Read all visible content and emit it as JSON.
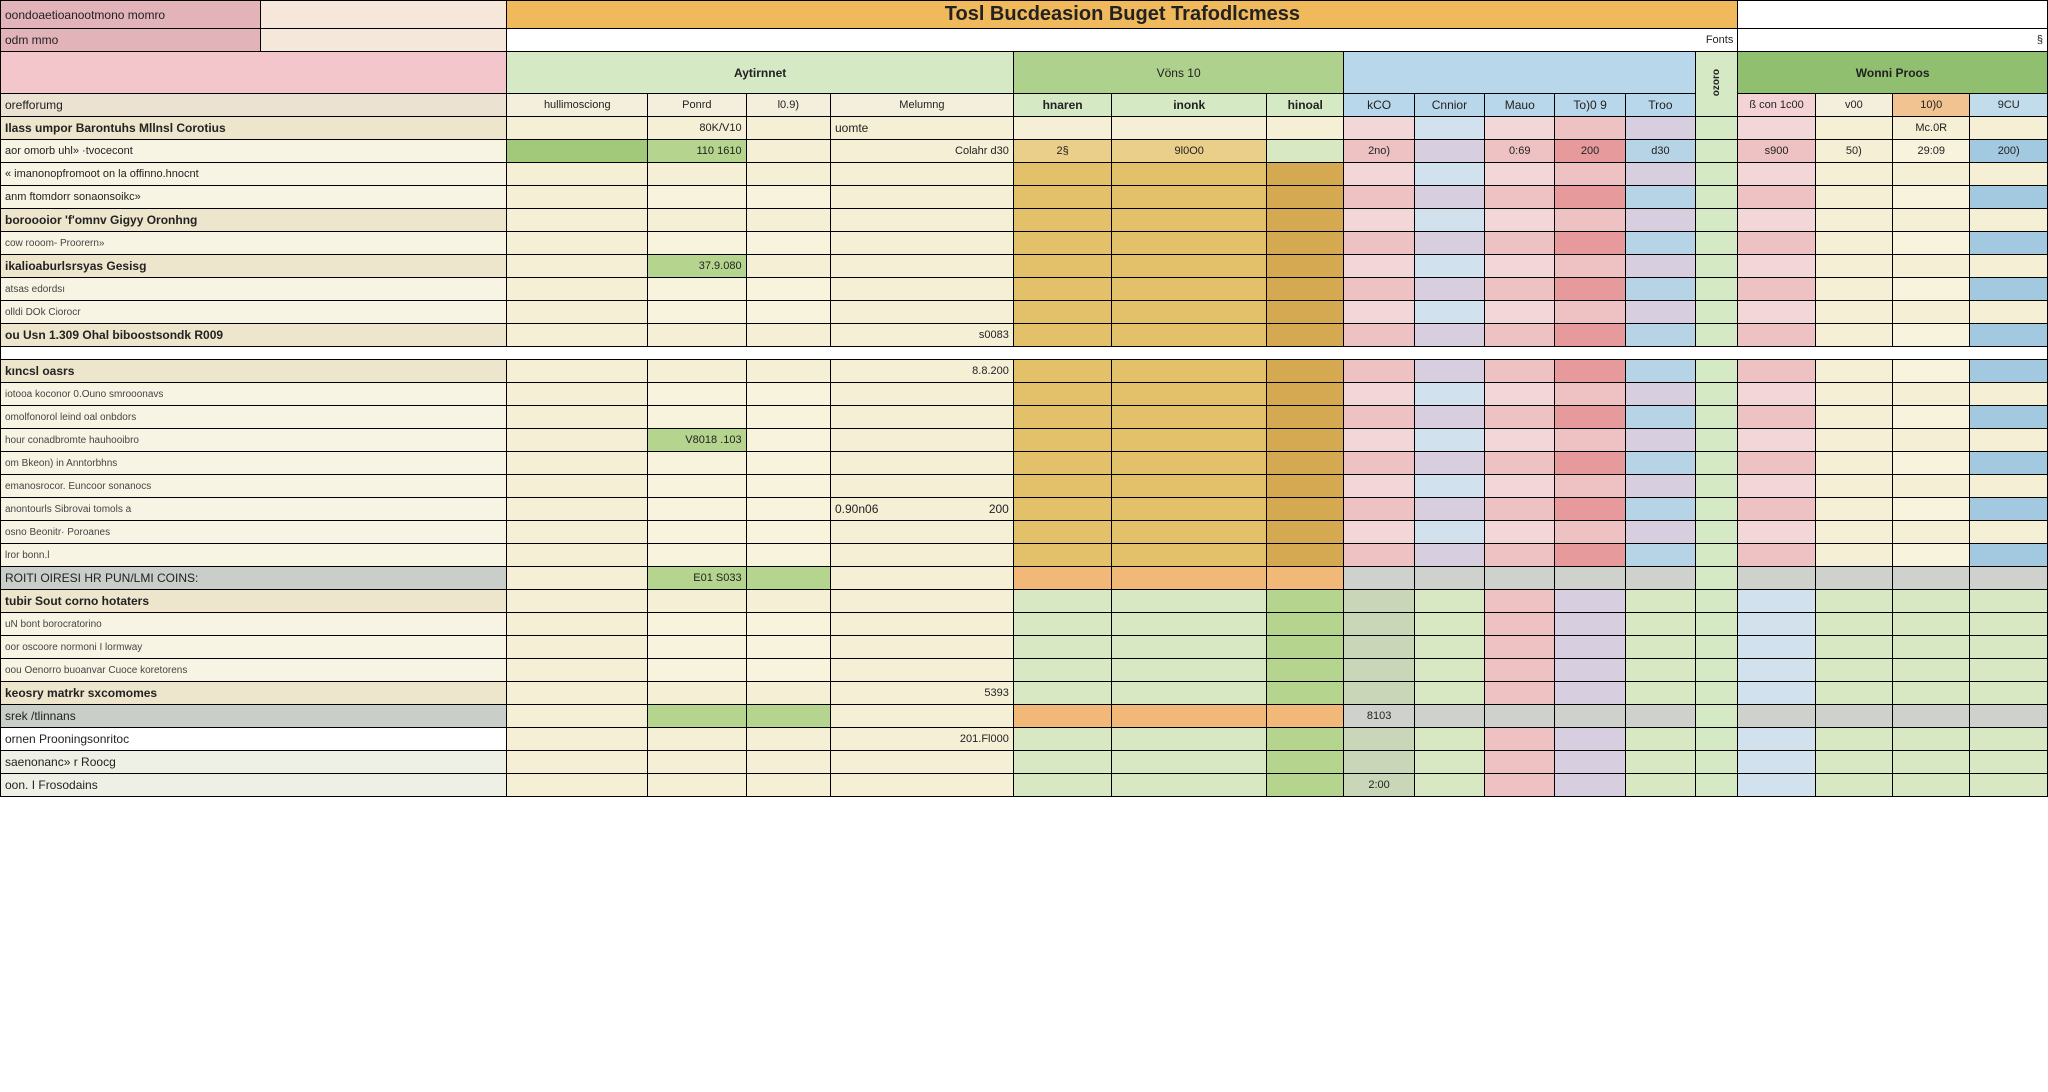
{
  "title": "Tosl Bucdeasion Buget Trafodlcmess",
  "subbar_right": "Fonts",
  "subbar_far": "§",
  "top_left": {
    "a": "oondoaetioanootmono momro",
    "b": "odm mmo",
    "c": "",
    "d": "orefforumg"
  },
  "group_headers": {
    "aytinnet": "Aytirnnet",
    "aytinnet_sub1": "hullimosciong",
    "aytinnet_sub2": "Ponrd",
    "aytinnet_sub3": "l0.9)",
    "aytinnet_sub4": "Melumng",
    "vons10": "Vöns 10",
    "vons_sub1": "hnaren",
    "vons_sub2": "inonk",
    "vons_sub3": "hinoal",
    "kco": "kCO",
    "cnnior": "Cnnior",
    "mauo": "Mauo",
    "tooo": "To)0 9",
    "troo": "Troo",
    "ver": "ozoro",
    "wonni": "Wonni Proos",
    "wonni_sub1": "ß con 1c00",
    "wonni_sub2": "v00",
    "wonni_sub3": "10)0",
    "wonni_sub4": "9CU"
  },
  "rows": [
    {
      "k": "sec",
      "l1": "Ilass umpor Barontuhs Mllnsl Corotius",
      "l2": ""
    },
    {
      "k": "r",
      "l1": "aor omorb uhl» ·tvocecont",
      "l2": "",
      "b1": "",
      "b2": "110 1610",
      "b4": "Colahr d30",
      "c1": "2§",
      "c2": "9l0O0",
      "d": [
        "2no)",
        "",
        "0:69",
        "200",
        "d30"
      ],
      "e": [
        "s900",
        "50)",
        "29:09",
        "200)"
      ]
    },
    {
      "k": "r",
      "l1": "« imanonopfromoot on la offinno.hnocnt",
      "l2": "",
      "b2": "",
      "b4": "",
      "grid": "mustard"
    },
    {
      "k": "r",
      "l1": "anm ftomdorr sonaonsoikc»",
      "l2": ""
    },
    {
      "k": "sec",
      "l1": "boroooior 'f'omnv Gigyy Oronhng",
      "l2": ""
    },
    {
      "k": "sub",
      "l1": "cow rooom- Proorern»",
      "l2": ""
    },
    {
      "k": "sec",
      "l1": "ikalioaburlsrsyas  Gesisg",
      "l2": "",
      "b2": "37.9.080"
    },
    {
      "k": "sub",
      "l1": "atsas edordsı",
      "l2": ""
    },
    {
      "k": "sub",
      "l1": "olldi DOk Ciorocr",
      "l2": ""
    },
    {
      "k": "sec",
      "l1": "ou Usn 1.309 Ohal biboostsondk  R009",
      "l2": "",
      "b4": "s0083"
    },
    {
      "k": "blank"
    },
    {
      "k": "sec",
      "l1": "kıncsl oasrs",
      "l2": "",
      "b4": "8.8.200"
    },
    {
      "k": "sub",
      "l1": "iotooa koconor 0.Ouno smrooonavs",
      "l2": ""
    },
    {
      "k": "sub",
      "l1": "omolfonorol leind oal  onbdors",
      "l2": ""
    },
    {
      "k": "sub",
      "l1": "hour conadbromte hauhooibro",
      "l2": "",
      "b2": "V8018 .103"
    },
    {
      "k": "sub",
      "l1": "om Bkeon) in Anntorbhns",
      "l2": ""
    },
    {
      "k": "sub",
      "l1": "emanosrocor.  Euncoor sonanocs",
      "l2": ""
    },
    {
      "k": "sub",
      "l1": "anontourls  Sibrovai tomols a",
      "l2": "",
      "b4l": "0.90n06",
      "b4r": "200"
    },
    {
      "k": "sub",
      "l1": "osno Beonitr· Poroanes",
      "l2": ""
    },
    {
      "k": "sub",
      "l1": "lror bonn.l",
      "l2": ""
    },
    {
      "k": "grey",
      "l1": "ROITI OIRESI HR PUN/LMI COINS:",
      "l2": "",
      "b2": "E01 S033"
    },
    {
      "k": "sec2",
      "l1": "tubir Sout corno hotaters",
      "l2": ""
    },
    {
      "k": "sub",
      "l1": "uN bont borocratorino",
      "l2": ""
    },
    {
      "k": "sub",
      "l1": "oor oscoore normoni I lormway",
      "l2": ""
    },
    {
      "k": "sub",
      "l1": "oou Oenorro buoanvar Cuoce koretorens",
      "l2": ""
    },
    {
      "k": "sec2",
      "l1": "keosry matrkr sxcomomes",
      "l2": "",
      "b4": "5393"
    },
    {
      "k": "grey",
      "l1": "srek /tlinnans",
      "l2": "",
      "d0": "8103"
    },
    {
      "k": "white",
      "l1": "ornen Prooningsonritoc",
      "l2": "",
      "b4": "201.Fl000"
    },
    {
      "k": "pale",
      "l1": "saenonanc» r Roocg",
      "l2": ""
    },
    {
      "k": "pale",
      "l1": "oon. I Frosodains",
      "l2": "",
      "d0": "2:00"
    }
  ],
  "palette_rows": {
    "default": [
      "c-pink1",
      "c-blue1",
      "c-pink1",
      "c-pink2",
      "c-lilac",
      "c-pink1",
      "c-cream",
      "c-cream",
      "c-cream",
      "c-cream"
    ],
    "mustard": [
      "c-pink2",
      "c-lilac",
      "c-pink2",
      "c-pink3",
      "c-blue2",
      "c-pink2",
      "c-cream",
      "c-cream2",
      "c-blue3",
      "c-blue2"
    ],
    "green": [
      "c-sage",
      "c-green1",
      "c-pink2",
      "c-lilac",
      "c-green1",
      "c-blue1",
      "c-green1",
      "c-green1",
      "c-green1",
      "c-blue2"
    ],
    "grey": [
      "c-grey",
      "c-grey",
      "c-grey",
      "c-grey",
      "c-grey",
      "c-grey",
      "c-grey",
      "c-grey",
      "c-grey",
      "c-grey"
    ]
  },
  "first_row_e_header": "Mc.0R"
}
